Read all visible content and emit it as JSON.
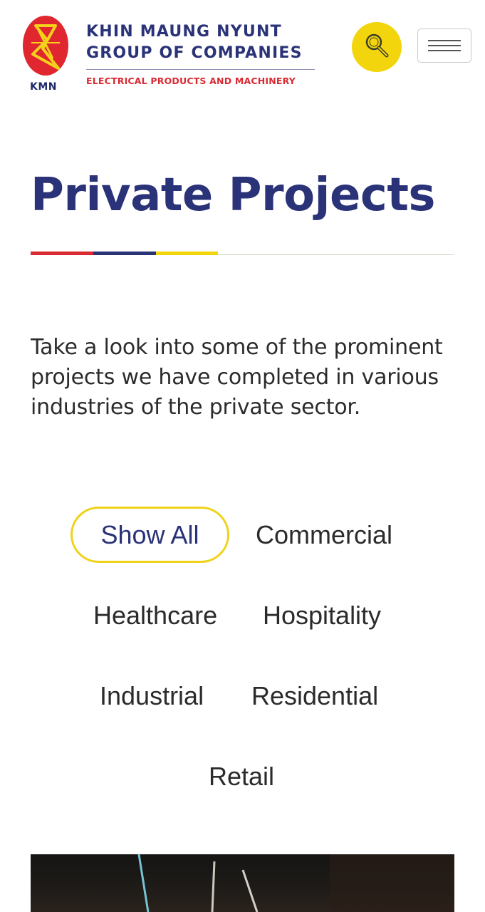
{
  "header": {
    "logo_abbr": "KMN",
    "company_line1": "KHIN MAUNG NYUNT",
    "company_line2": "GROUP OF COMPANIES",
    "tagline": "ELECTRICAL PRODUCTS AND MACHINERY",
    "search_icon": "search-icon",
    "menu_icon": "hamburger-menu-icon"
  },
  "page": {
    "title": "Private Projects",
    "intro": "Take a look into some of the prominent projects we have completed in various industries of the private sector."
  },
  "filters": [
    {
      "label": "Show All",
      "active": true
    },
    {
      "label": "Commercial",
      "active": false
    },
    {
      "label": "Healthcare",
      "active": false
    },
    {
      "label": "Hospitality",
      "active": false
    },
    {
      "label": "Industrial",
      "active": false
    },
    {
      "label": "Residential",
      "active": false
    },
    {
      "label": "Retail",
      "active": false
    }
  ],
  "colors": {
    "brand_navy": "#2a3278",
    "brand_red": "#d92a32",
    "brand_yellow": "#f2d50c",
    "active_filter_border": "#f0d21a"
  }
}
